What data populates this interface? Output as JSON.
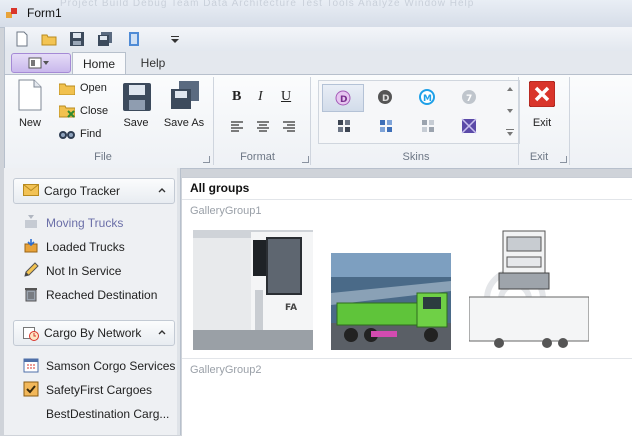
{
  "window": {
    "title": "Form1",
    "background_menu_ghost": "Project Build Debug Team Data Architecture Test Tools Analyze Window Help"
  },
  "quick_access": {
    "icons": [
      "new-icon",
      "open-folder-icon",
      "save-icon",
      "save-all-icon",
      "document-icon",
      "customize-dropdown-icon"
    ]
  },
  "ribbon": {
    "tabs": [
      {
        "label": "Home",
        "active": true
      },
      {
        "label": "Help",
        "active": false
      }
    ],
    "groups": {
      "file": {
        "label": "File",
        "new_label": "New",
        "open_label": "Open",
        "close_label": "Close",
        "find_label": "Find",
        "save_label": "Save",
        "save_as_label": "Save As"
      },
      "format": {
        "label": "Format"
      },
      "skins": {
        "label": "Skins"
      },
      "exit": {
        "label": "Exit",
        "exit_label": "Exit"
      }
    }
  },
  "nav": {
    "cargo_tracker": {
      "header": "Cargo Tracker",
      "items": [
        {
          "label": "Moving Trucks",
          "icon": "moving-truck-icon",
          "selected": true
        },
        {
          "label": "Loaded Trucks",
          "icon": "loaded-box-icon"
        },
        {
          "label": "Not In Service",
          "icon": "pencil-icon"
        },
        {
          "label": "Reached Destination",
          "icon": "trash-icon"
        }
      ]
    },
    "cargo_by_network": {
      "header": "Cargo By Network",
      "items": [
        {
          "label": "Samson Corgo Services",
          "icon": "calendar-icon"
        },
        {
          "label": "SafetyFirst Cargoes",
          "icon": "checkbox-icon"
        },
        {
          "label": "BestDestination Carg...",
          "icon": ""
        }
      ]
    }
  },
  "gallery": {
    "title": "All groups",
    "groups": [
      "GalleryGroup1",
      "GalleryGroup2"
    ]
  },
  "colors": {
    "accent_purple": "#a58ad6",
    "exit_red": "#d9352b",
    "truck_green": "#5fc43a"
  }
}
